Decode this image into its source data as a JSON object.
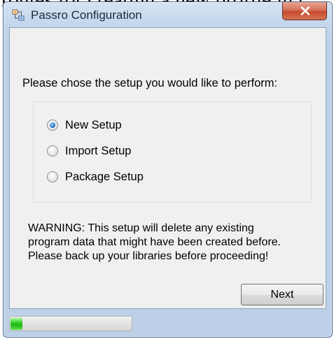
{
  "background_text": "t routes for creating a new profile in t",
  "window": {
    "title": "Passro Configuration",
    "icon": "app-network-icon",
    "close_glyph": "close-icon"
  },
  "main": {
    "prompt": "Please chose the setup you would like to perform:",
    "options": [
      {
        "label": "New Setup",
        "checked": true
      },
      {
        "label": "Import Setup",
        "checked": false
      },
      {
        "label": "Package Setup",
        "checked": false
      }
    ],
    "warning_lines": [
      "WARNING: This setup will delete any existing",
      "program data that might have been created before.",
      "Please back up your libraries before proceeding!"
    ],
    "next_label": "Next"
  },
  "status": {
    "progress_fraction": 0.1
  },
  "colors": {
    "progress_green": "#2bc41e",
    "close_red": "#c74a2f",
    "title_blue": "#c4d7ec"
  }
}
